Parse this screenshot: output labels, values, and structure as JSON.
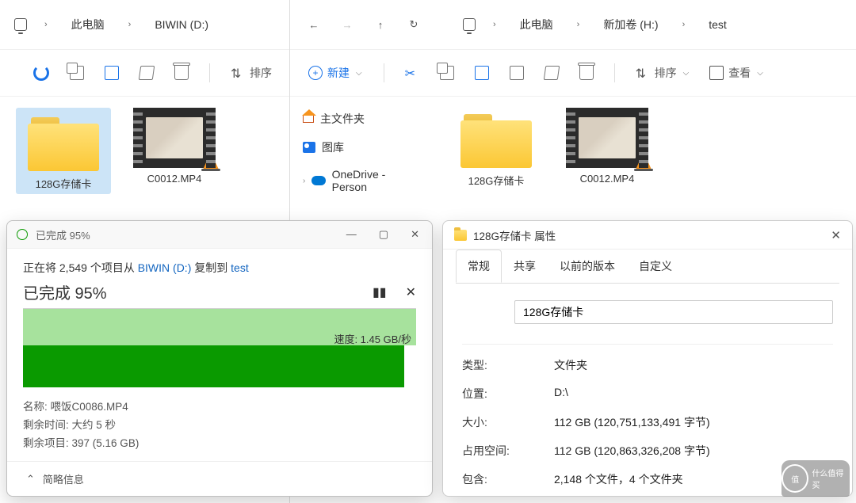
{
  "explorer_left": {
    "breadcrumb": {
      "pc": "此电脑",
      "drive": "BIWIN (D:)"
    },
    "toolbar": {
      "sort": "排序"
    },
    "files": {
      "folder": "128G存储卡",
      "video": "C0012.MP4"
    }
  },
  "explorer_right": {
    "breadcrumb": {
      "pc": "此电脑",
      "vol": "新加卷 (H:)",
      "dir": "test"
    },
    "toolbar": {
      "new": "新建",
      "sort": "排序",
      "view": "查看"
    },
    "navtree": {
      "home": "主文件夹",
      "gallery": "图库",
      "onedrive": "OneDrive - Person"
    },
    "files": {
      "folder": "128G存储卡",
      "video": "C0012.MP4"
    }
  },
  "copy_dialog": {
    "title": "已完成 95%",
    "line_prefix": "正在将 2,549 个项目从 ",
    "line_src": "BIWIN (D:)",
    "line_mid": " 复制到 ",
    "line_dst": "test",
    "percent": "已完成 95%",
    "speed_label": "速度: 1.45 GB/秒",
    "name_label": "名称: ",
    "name_value": "喂饭C0086.MP4",
    "remain_label": "剩余时间: ",
    "remain_value": "大约 5 秒",
    "items_label": "剩余项目: ",
    "items_value": "397 (5.16 GB)",
    "footer": "简略信息"
  },
  "props_dialog": {
    "title": "128G存储卡 属性",
    "tabs": {
      "general": "常规",
      "share": "共享",
      "prev": "以前的版本",
      "custom": "自定义"
    },
    "name": "128G存储卡",
    "rows": {
      "type_k": "类型:",
      "type_v": "文件夹",
      "loc_k": "位置:",
      "loc_v": "D:\\",
      "size_k": "大小:",
      "size_v": "112 GB (120,751,133,491 字节)",
      "ondisk_k": "占用空间:",
      "ondisk_v": "112 GB (120,863,326,208 字节)",
      "contains_k": "包含:",
      "contains_v": "2,148 个文件，4 个文件夹"
    }
  },
  "watermark": {
    "char": "值",
    "text": "什么值得买"
  }
}
